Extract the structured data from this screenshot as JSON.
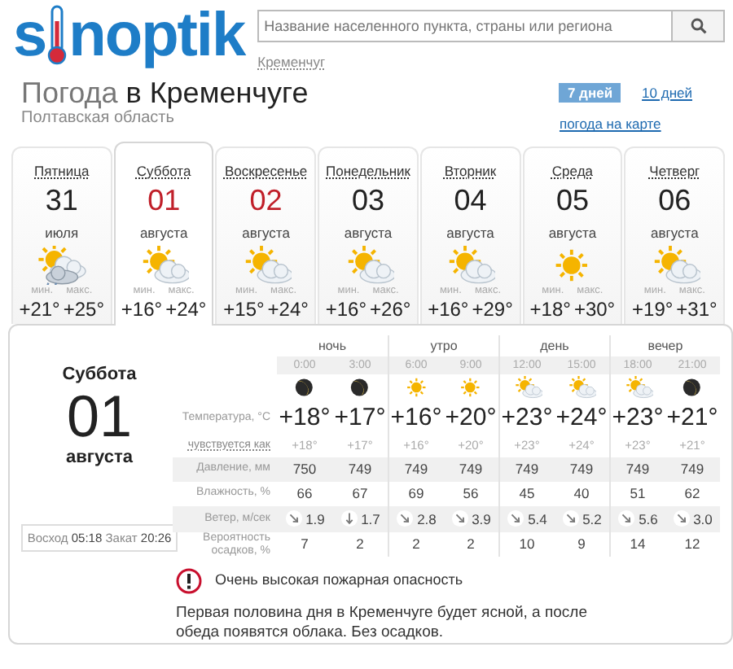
{
  "logo": {
    "before": "s",
    "after": "noptik"
  },
  "search": {
    "placeholder": "Название населенного пункта, страны или региона",
    "hint": "Кременчуг"
  },
  "heading": {
    "prefix": "Погода",
    "city": "в Кременчуге",
    "region": "Полтавская область"
  },
  "range_tabs": [
    {
      "label": "7 дней",
      "selected": true
    },
    {
      "label": "10 дней",
      "selected": false
    }
  ],
  "map_link": "погода на карте",
  "days": [
    {
      "weekday": "Пятница",
      "date": "31",
      "month": "июля",
      "weather": {
        "kind": "cloud-rain"
      },
      "min_label": "мин.",
      "min": "+21°",
      "max_label": "макс.",
      "max": "+25°",
      "weekend": false,
      "selected": false
    },
    {
      "weekday": "Суббота",
      "date": "01",
      "month": "августа",
      "weather": {
        "kind": "partly-cloudy"
      },
      "min_label": "мин.",
      "min": "+16°",
      "max_label": "макс.",
      "max": "+24°",
      "weekend": true,
      "selected": true
    },
    {
      "weekday": "Воскресенье",
      "date": "02",
      "month": "августа",
      "weather": {
        "kind": "partly-cloudy"
      },
      "min_label": "мин.",
      "min": "+15°",
      "max_label": "макс.",
      "max": "+24°",
      "weekend": true,
      "selected": false
    },
    {
      "weekday": "Понедельник",
      "date": "03",
      "month": "августа",
      "weather": {
        "kind": "partly-cloudy"
      },
      "min_label": "мин.",
      "min": "+16°",
      "max_label": "макс.",
      "max": "+26°",
      "weekend": false,
      "selected": false
    },
    {
      "weekday": "Вторник",
      "date": "04",
      "month": "августа",
      "weather": {
        "kind": "partly-cloudy"
      },
      "min_label": "мин.",
      "min": "+16°",
      "max_label": "макс.",
      "max": "+29°",
      "weekend": false,
      "selected": false
    },
    {
      "weekday": "Среда",
      "date": "05",
      "month": "августа",
      "weather": {
        "kind": "sun"
      },
      "min_label": "мин.",
      "min": "+18°",
      "max_label": "макс.",
      "max": "+30°",
      "weekend": false,
      "selected": false
    },
    {
      "weekday": "Четверг",
      "date": "06",
      "month": "августа",
      "weather": {
        "kind": "partly-cloudy"
      },
      "min_label": "мин.",
      "min": "+19°",
      "max_label": "макс.",
      "max": "+31°",
      "weekend": false,
      "selected": false
    }
  ],
  "detail": {
    "weekday": "Суббота",
    "date": "01",
    "month": "августа",
    "sun": {
      "rise_label": "Восход",
      "rise": "05:18",
      "set_label": "Закат",
      "set": "20:26"
    },
    "periods": [
      "ночь",
      "утро",
      "день",
      "вечер"
    ],
    "times": [
      "0:00",
      "3:00",
      "6:00",
      "9:00",
      "12:00",
      "15:00",
      "18:00",
      "21:00"
    ],
    "sky": [
      {
        "kind": "moon"
      },
      {
        "kind": "moon"
      },
      {
        "kind": "sun"
      },
      {
        "kind": "sun"
      },
      {
        "kind": "partly-cloudy"
      },
      {
        "kind": "partly-cloudy"
      },
      {
        "kind": "partly-cloudy"
      },
      {
        "kind": "moon"
      }
    ],
    "rows": [
      {
        "kind": "temp",
        "label": "Температура, °C",
        "shaded": false,
        "values": [
          "+18°",
          "+17°",
          "+16°",
          "+20°",
          "+23°",
          "+24°",
          "+23°",
          "+21°"
        ]
      },
      {
        "kind": "feel",
        "label": "чувствуется как",
        "shaded": false,
        "values": [
          "+18°",
          "+17°",
          "+16°",
          "+20°",
          "+23°",
          "+24°",
          "+23°",
          "+21°"
        ]
      },
      {
        "kind": "plain",
        "label": "Давление, мм",
        "shaded": true,
        "values": [
          "750",
          "749",
          "749",
          "749",
          "749",
          "749",
          "749",
          "749"
        ]
      },
      {
        "kind": "plain",
        "label": "Влажность, %",
        "shaded": false,
        "values": [
          "66",
          "67",
          "69",
          "56",
          "45",
          "40",
          "51",
          "62"
        ]
      },
      {
        "kind": "wind",
        "label": "Ветер, м/сек",
        "shaded": true,
        "values": [
          {
            "arrow": {
              "kind": "nw"
            },
            "speed": "1.9"
          },
          {
            "arrow": {
              "kind": "n"
            },
            "speed": "1.7"
          },
          {
            "arrow": {
              "kind": "nw"
            },
            "speed": "2.8"
          },
          {
            "arrow": {
              "kind": "nw"
            },
            "speed": "3.9"
          },
          {
            "arrow": {
              "kind": "nw"
            },
            "speed": "5.4"
          },
          {
            "arrow": {
              "kind": "nw"
            },
            "speed": "5.2"
          },
          {
            "arrow": {
              "kind": "nw"
            },
            "speed": "5.6"
          },
          {
            "arrow": {
              "kind": "nw"
            },
            "speed": "3.0"
          }
        ]
      },
      {
        "kind": "plain",
        "label": "Вероятность осадков, %",
        "shaded": false,
        "values": [
          "7",
          "2",
          "2",
          "2",
          "10",
          "9",
          "14",
          "12"
        ]
      }
    ],
    "warning": "Очень высокая пожарная опасность",
    "description": "Первая половина дня в Кременчуге будет ясной, а после обеда появятся облака. Без осадков."
  }
}
